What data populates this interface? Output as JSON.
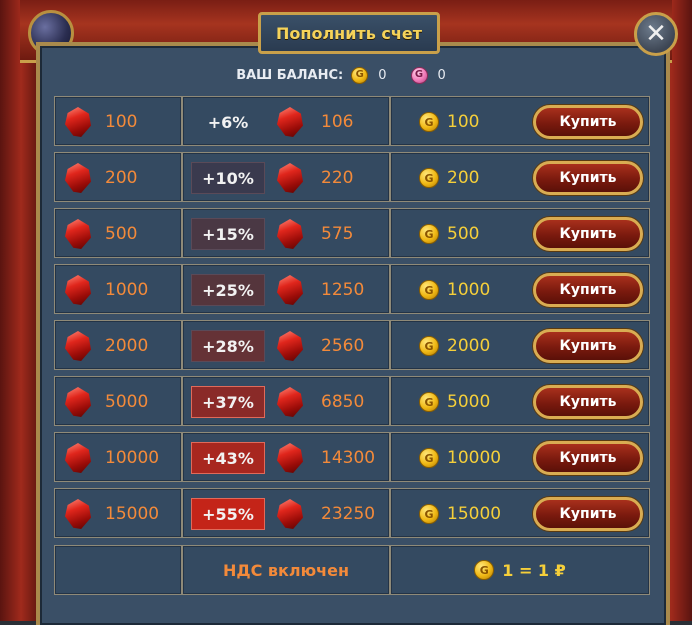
{
  "title": "Пополнить счет",
  "close_icon": "close-icon",
  "balance": {
    "label": "ВАШ БАЛАНС:",
    "gold_coin_icon_letter": "G",
    "gold_value": "0",
    "pink_coin_icon_letter": "G",
    "pink_value": "0"
  },
  "buy_label": "Купить",
  "rows": [
    {
      "base": "100",
      "bonus": "+6%",
      "total": "106",
      "price": "100"
    },
    {
      "base": "200",
      "bonus": "+10%",
      "total": "220",
      "price": "200"
    },
    {
      "base": "500",
      "bonus": "+15%",
      "total": "575",
      "price": "500"
    },
    {
      "base": "1000",
      "bonus": "+25%",
      "total": "1250",
      "price": "1000"
    },
    {
      "base": "2000",
      "bonus": "+28%",
      "total": "2560",
      "price": "2000"
    },
    {
      "base": "5000",
      "bonus": "+37%",
      "total": "6850",
      "price": "5000"
    },
    {
      "base": "10000",
      "bonus": "+43%",
      "total": "14300",
      "price": "10000"
    },
    {
      "base": "15000",
      "bonus": "+55%",
      "total": "23250",
      "price": "15000"
    }
  ],
  "bonus_colors": [
    "transparent",
    "#3a3a4e",
    "#4a3844",
    "#55353c",
    "#653236",
    "#8a2a28",
    "#a8271f",
    "#c42418"
  ],
  "footer": {
    "vat": "НДС включен",
    "rate": "1 = 1 ₽"
  }
}
